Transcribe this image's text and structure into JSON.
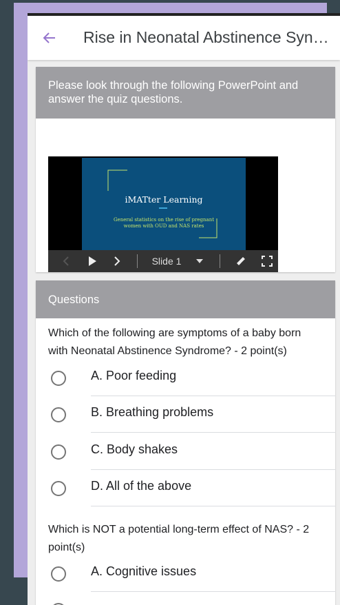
{
  "app": {
    "title": "Rise in Neonatal Abstinence Syndrome",
    "accent": "#9575cd"
  },
  "intro": {
    "text": "Please look through the following PowerPoint and answer the quiz questions."
  },
  "slides": {
    "title": "iMATter Learning",
    "subtitle": "General statistics on the rise of pregnant women with OUD and NAS rates",
    "slide_label": "Slide 1"
  },
  "questions_section": {
    "header": "Questions",
    "items": [
      {
        "text": "Which of the following are symptoms of a baby born with Neonatal Abstinence Syndrome? - 2 point(s)",
        "options": [
          "A. Poor feeding",
          "B. Breathing problems",
          "C. Body shakes",
          "D. All of the above"
        ]
      },
      {
        "text": "Which is NOT a potential long-term effect of NAS? - 2 point(s)",
        "options": [
          "A. Cognitive issues"
        ]
      }
    ]
  }
}
